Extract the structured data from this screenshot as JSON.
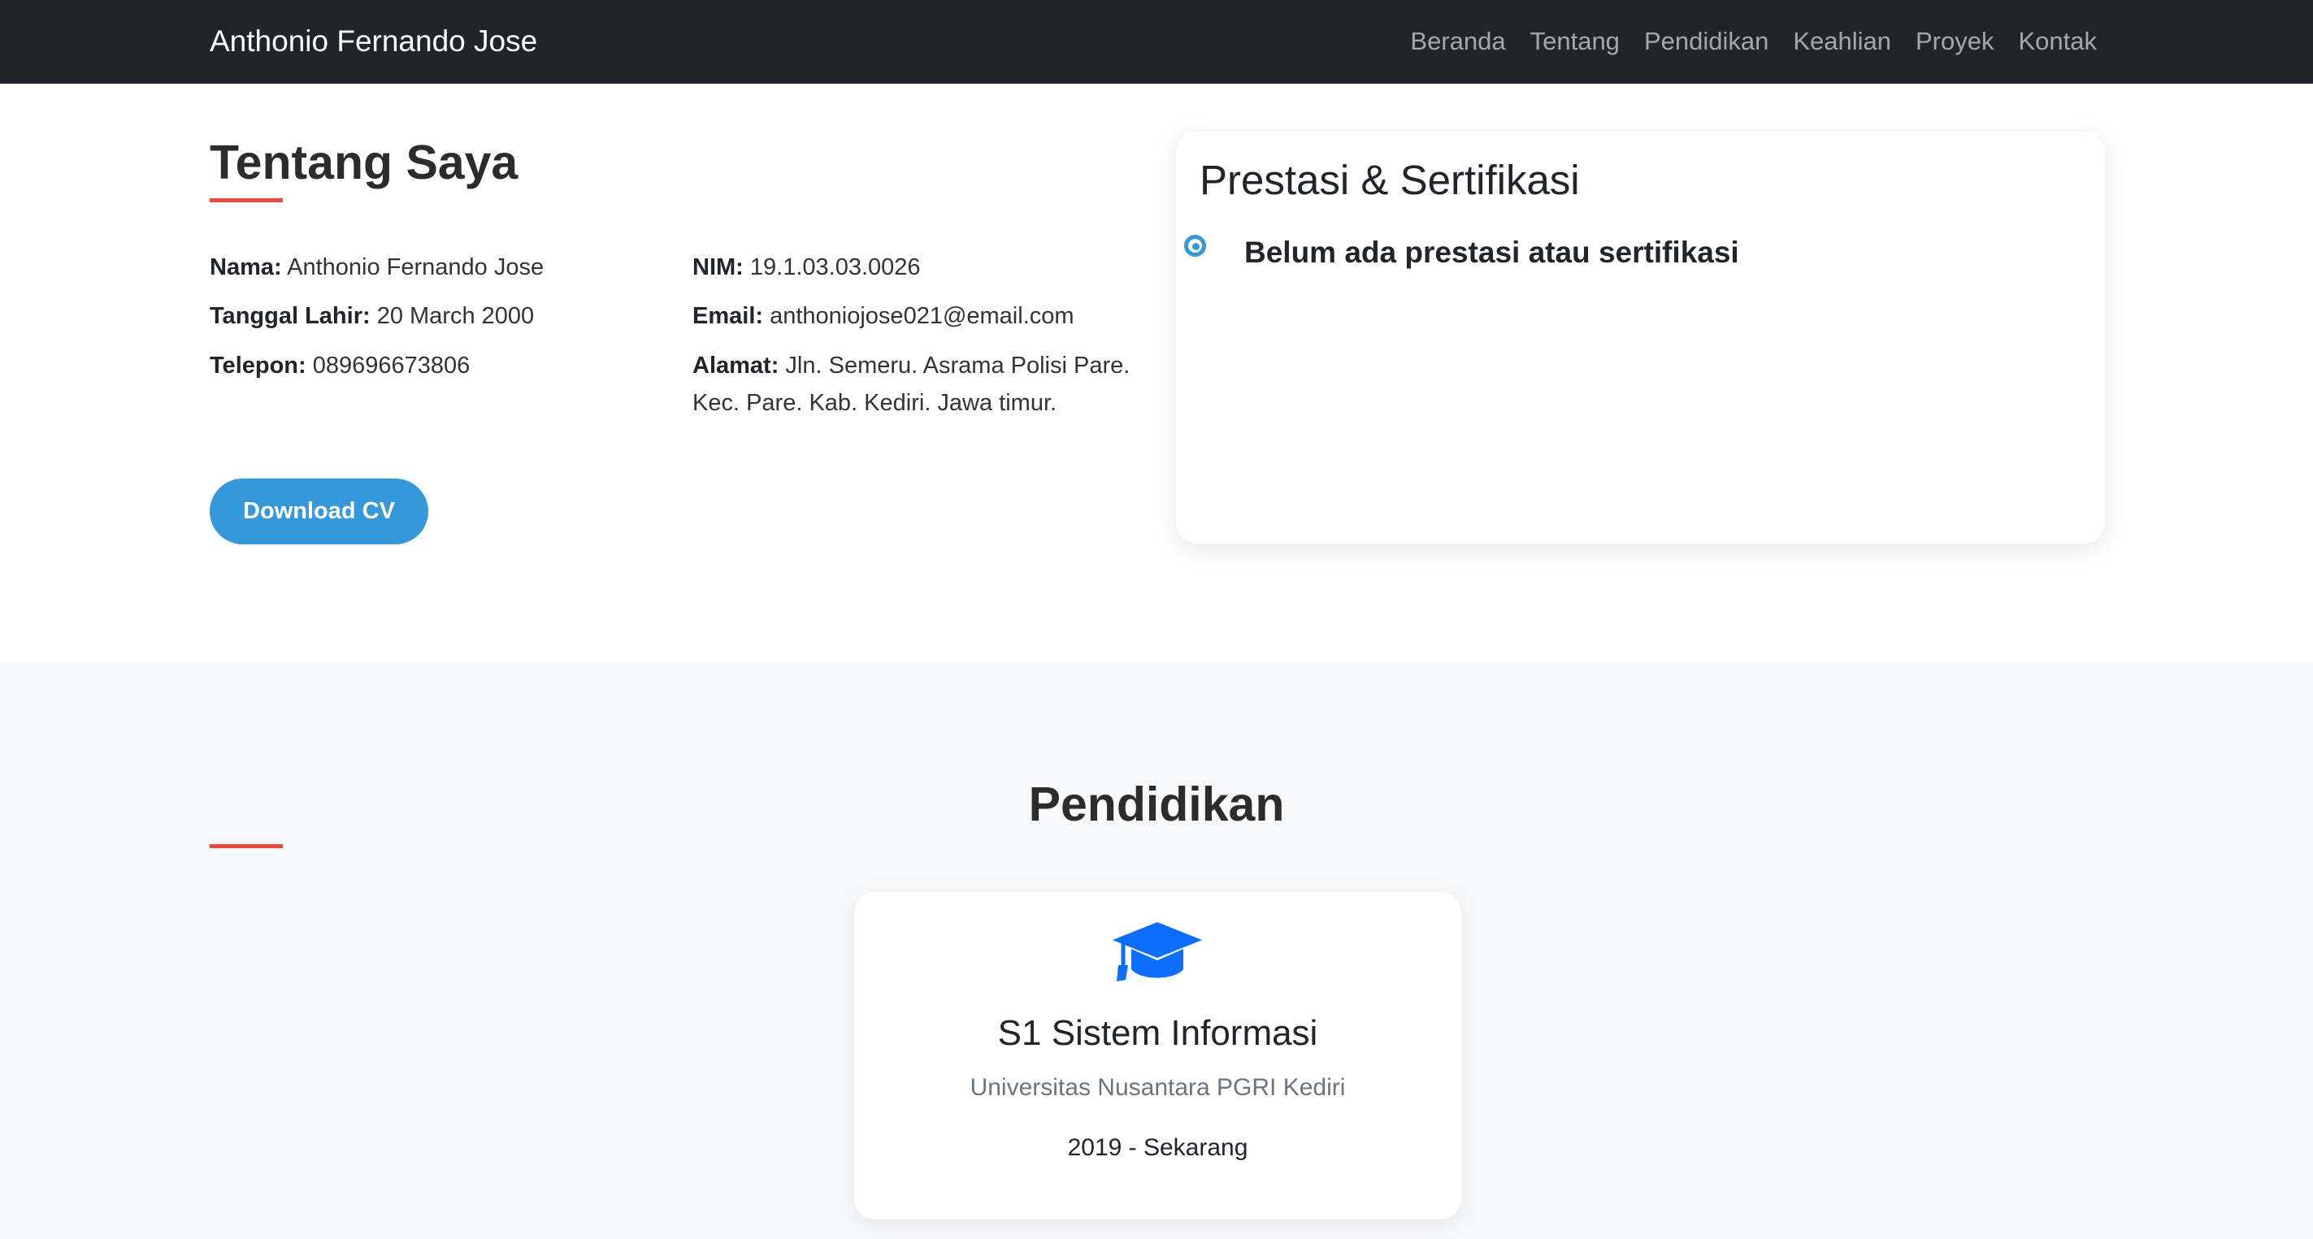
{
  "nav": {
    "brand": "Anthonio Fernando Jose",
    "links": [
      "Beranda",
      "Tentang",
      "Pendidikan",
      "Keahlian",
      "Proyek",
      "Kontak"
    ]
  },
  "about": {
    "title": "Tentang Saya",
    "name_label": "Nama:",
    "name_value": "Anthonio Fernando Jose",
    "birth_label": "Tanggal Lahir:",
    "birth_value": "20 March 2000",
    "phone_label": "Telepon:",
    "phone_value": "089696673806",
    "nim_label": "NIM:",
    "nim_value": "19.1.03.03.0026",
    "email_label": "Email:",
    "email_value": "anthoniojose021@email.com",
    "address_label": "Alamat:",
    "address_line1": "Jln. Semeru. Asrama Polisi Pare.",
    "address_line2": "Kec. Pare. Kab. Kediri. Jawa timur.",
    "cv_button": "Download CV"
  },
  "achievements": {
    "title": "Prestasi & Sertifikasi",
    "empty_text": "Belum ada prestasi atau sertifikasi"
  },
  "education": {
    "title": "Pendidikan",
    "degree": "S1 Sistem Informasi",
    "school": "Universitas Nusantara PGRI Kediri",
    "years": "2019 - Sekarang",
    "icon": "graduation-cap-icon"
  },
  "colors": {
    "navbar": "#212529",
    "accent": "#e74c3c",
    "primary": "#3498db",
    "icon_blue": "#0d6efd",
    "section_bg": "#f8f9fa"
  }
}
